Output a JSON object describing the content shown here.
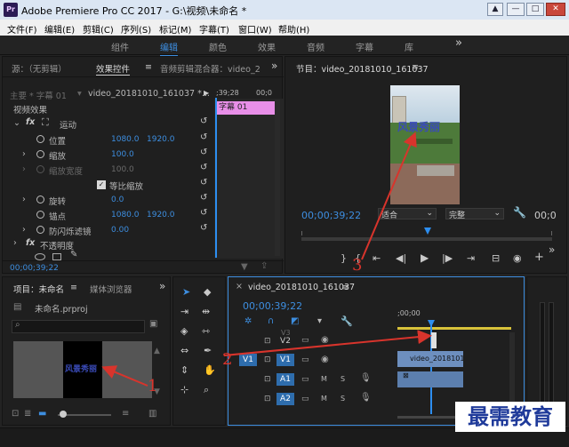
{
  "window": {
    "title": "Adobe Premiere Pro CC 2017 - G:\\视频\\未命名 *",
    "logo_text": "Pr",
    "min": "—",
    "max": "□",
    "close": "✕",
    "extra": "▲"
  },
  "menu": [
    "文件(F)",
    "编辑(E)",
    "剪辑(C)",
    "序列(S)",
    "标记(M)",
    "字幕(T)",
    "窗口(W)",
    "帮助(H)"
  ],
  "workspaces": [
    "组件",
    "编辑",
    "颜色",
    "效果",
    "音频",
    "字幕",
    "库"
  ],
  "workspace_more": "»",
  "source_panel": {
    "tabs": [
      "源：（无剪辑）",
      "效果控件",
      "音频剪辑混合器：video_2"
    ],
    "menu_icon": "≡",
    "more": "»",
    "master_label": "主要 * 字幕 01",
    "clip_label": "video_20181010_161037 *...",
    "mini_time1": ";39;28",
    "mini_time2": "00;0",
    "title_clip": "字幕 01",
    "section_video": "视频效果",
    "fx_motion": "运动",
    "props": [
      {
        "name": "位置",
        "v1": "1080.0",
        "v2": "1920.0"
      },
      {
        "name": "缩放",
        "v1": "100.0",
        "v2": ""
      },
      {
        "name": "缩放宽度",
        "v1": "100.0",
        "v2": ""
      },
      {
        "name": "等比缩放",
        "v1": "",
        "v2": ""
      },
      {
        "name": "旋转",
        "v1": "0.0",
        "v2": ""
      },
      {
        "name": "锚点",
        "v1": "1080.0",
        "v2": "1920.0"
      },
      {
        "name": "防闪烁滤镜",
        "v1": "0.00",
        "v2": ""
      }
    ],
    "fx_opacity": "不透明度",
    "fx_label": "fx",
    "timecode": "00;00;39;22"
  },
  "program": {
    "title": "节目：video_20181010_161037",
    "timecode": "00;00;39;22",
    "fit": "适合",
    "quality": "完整",
    "right_time": "00;0",
    "video_text": "风景秀丽",
    "more": "»"
  },
  "project": {
    "tabs": [
      "项目：未命名",
      "媒体浏览器"
    ],
    "more": "»",
    "file": "未命名.prproj",
    "thumb_text": "风景秀丽"
  },
  "timeline": {
    "title": "video_20181010_161037",
    "timecode": "00;00;39;22",
    "ruler": ";00;00",
    "tracks": [
      {
        "src": "",
        "name": "V3"
      },
      {
        "src": "",
        "name": "V2"
      },
      {
        "src": "V1",
        "name": "V1"
      },
      {
        "src": "",
        "name": "A1"
      },
      {
        "src": "",
        "name": "A2"
      }
    ],
    "clip_video": "video_2018101",
    "m": "M",
    "s": "S"
  },
  "annotations": [
    "1",
    "2",
    "3"
  ],
  "watermark": "最需教育",
  "colors": {
    "accent": "#3d8ee0",
    "title_pink": "#e88fe8",
    "arrow": "#d8342c",
    "playhead": "#2d8ef0"
  }
}
